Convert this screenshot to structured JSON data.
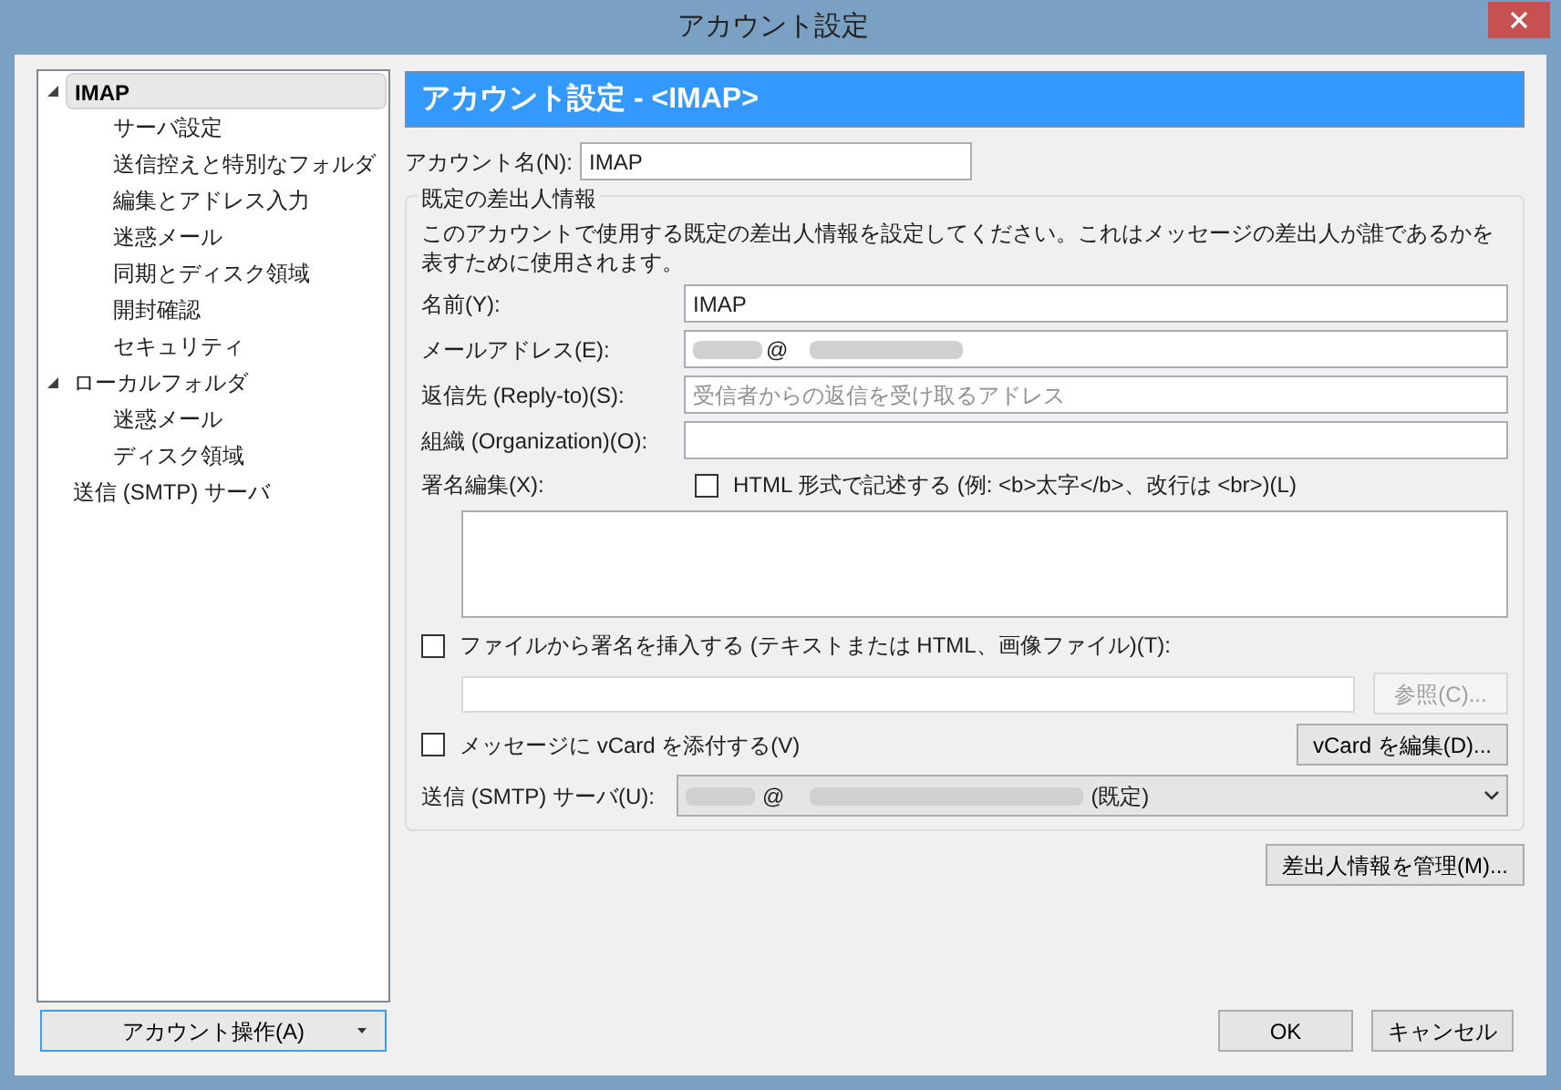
{
  "window": {
    "title": "アカウント設定"
  },
  "tree": [
    {
      "label": "IMAP",
      "selected": true,
      "expanded": true,
      "children": [
        {
          "label": "サーバ設定",
          "selected": false
        },
        {
          "label": "送信控えと特別なフォルダ",
          "selected": false
        },
        {
          "label": "編集とアドレス入力",
          "selected": false
        },
        {
          "label": "迷惑メール",
          "selected": false
        },
        {
          "label": "同期とディスク領域",
          "selected": false
        },
        {
          "label": "開封確認",
          "selected": false
        },
        {
          "label": "セキュリティ",
          "selected": false
        }
      ]
    },
    {
      "label": "ローカルフォルダ",
      "selected": false,
      "expanded": true,
      "children": [
        {
          "label": "迷惑メール",
          "selected": false
        },
        {
          "label": "ディスク領域",
          "selected": false
        }
      ]
    },
    {
      "label": "送信 (SMTP) サーバ",
      "selected": false
    }
  ],
  "account_actions_button": {
    "label": "アカウント操作(A)"
  },
  "header": "アカウント設定 - <IMAP>",
  "account_name": {
    "label": "アカウント名(N):",
    "value": "IMAP"
  },
  "identity": {
    "title": "既定の差出人情報",
    "description": "このアカウントで使用する既定の差出人情報を設定してください。これはメッセージの差出人が誰であるかを表すために使用されます。",
    "fields": [
      {
        "label": "名前(Y):",
        "value": "IMAP",
        "kind": "text"
      },
      {
        "label": "メールアドレス(E):",
        "value": "@",
        "kind": "redacted"
      },
      {
        "label": "返信先 (Reply-to)(S):",
        "placeholder": "受信者からの返信を受け取るアドレス",
        "kind": "text"
      },
      {
        "label": "組織 (Organization)(O):",
        "kind": "text"
      }
    ],
    "signature": {
      "label": "署名編集(X):",
      "html_option": {
        "label": "HTML 形式で記述する (例: <b>太字</b>、改行は <br>)(L)",
        "checked": false
      }
    },
    "file_signature": {
      "label": "ファイルから署名を挿入する (テキストまたは HTML、画像ファイル)(T):",
      "checked": false
    },
    "browse_button": {
      "label": "参照(C)...",
      "disabled": true
    },
    "vcard": {
      "label": "メッセージに vCard を添付する(V)",
      "checked": false
    },
    "vcard_button": {
      "label": "vCard を編集(D)..."
    },
    "smtp": {
      "label": "送信 (SMTP) サーバ(U):",
      "value": "@",
      "suffix": "(既定)"
    }
  },
  "manage_button": {
    "label": "差出人情報を管理(M)..."
  },
  "buttons": [
    "OK",
    "キャンセル"
  ]
}
